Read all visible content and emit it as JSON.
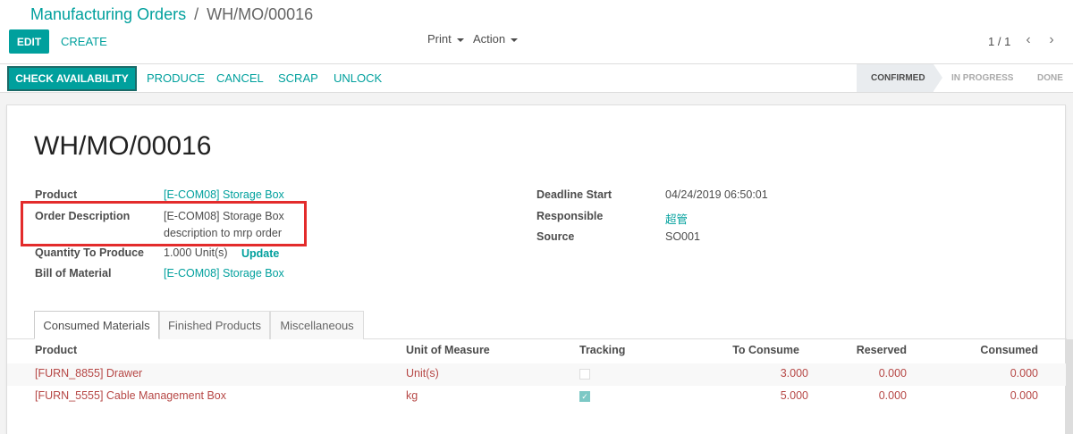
{
  "breadcrumb": {
    "parent": "Manufacturing Orders",
    "separator": "/",
    "current": "WH/MO/00016"
  },
  "toolbar": {
    "edit_label": "EDIT",
    "create_label": "CREATE",
    "print_label": "Print",
    "action_label": "Action"
  },
  "pager": {
    "value": "1 / 1",
    "prev_icon": "chevron-left-icon",
    "next_icon": "chevron-right-icon"
  },
  "statusbar": {
    "primary_button": "CHECK AVAILABILITY",
    "buttons": [
      "PRODUCE",
      "CANCEL",
      "SCRAP",
      "UNLOCK"
    ],
    "stages": [
      "CONFIRMED",
      "IN PROGRESS",
      "DONE"
    ],
    "active_stage": "CONFIRMED"
  },
  "form": {
    "title": "WH/MO/00016",
    "left": {
      "product_label": "Product",
      "product_value": "[E-COM08] Storage Box",
      "order_desc_label": "Order Description",
      "order_desc_line1": "[E-COM08] Storage Box",
      "order_desc_line2": "description to mrp order",
      "qty_label": "Quantity To Produce",
      "qty_value": "1.000",
      "qty_unit": "Unit(s)",
      "qty_update": "Update",
      "bom_label": "Bill of Material",
      "bom_value": "[E-COM08] Storage Box"
    },
    "right": {
      "deadline_label": "Deadline Start",
      "deadline_value": "04/24/2019 06:50:01",
      "responsible_label": "Responsible",
      "responsible_value": "超管",
      "source_label": "Source",
      "source_value": "SO001"
    }
  },
  "tabs": [
    "Consumed Materials",
    "Finished Products",
    "Miscellaneous"
  ],
  "table": {
    "columns": [
      "Product",
      "Unit of Measure",
      "Tracking",
      "To Consume",
      "Reserved",
      "Consumed"
    ],
    "rows": [
      {
        "product": "[FURN_8855] Drawer",
        "uom": "Unit(s)",
        "tracking": false,
        "to_consume": "3.000",
        "reserved": "0.000",
        "consumed": "0.000"
      },
      {
        "product": "[FURN_5555] Cable Management Box",
        "uom": "kg",
        "tracking": true,
        "to_consume": "5.000",
        "reserved": "0.000",
        "consumed": "0.000"
      }
    ]
  },
  "colors": {
    "accent": "#00a09d",
    "row_text": "#b64745",
    "highlight_box": "#e32b2b"
  }
}
